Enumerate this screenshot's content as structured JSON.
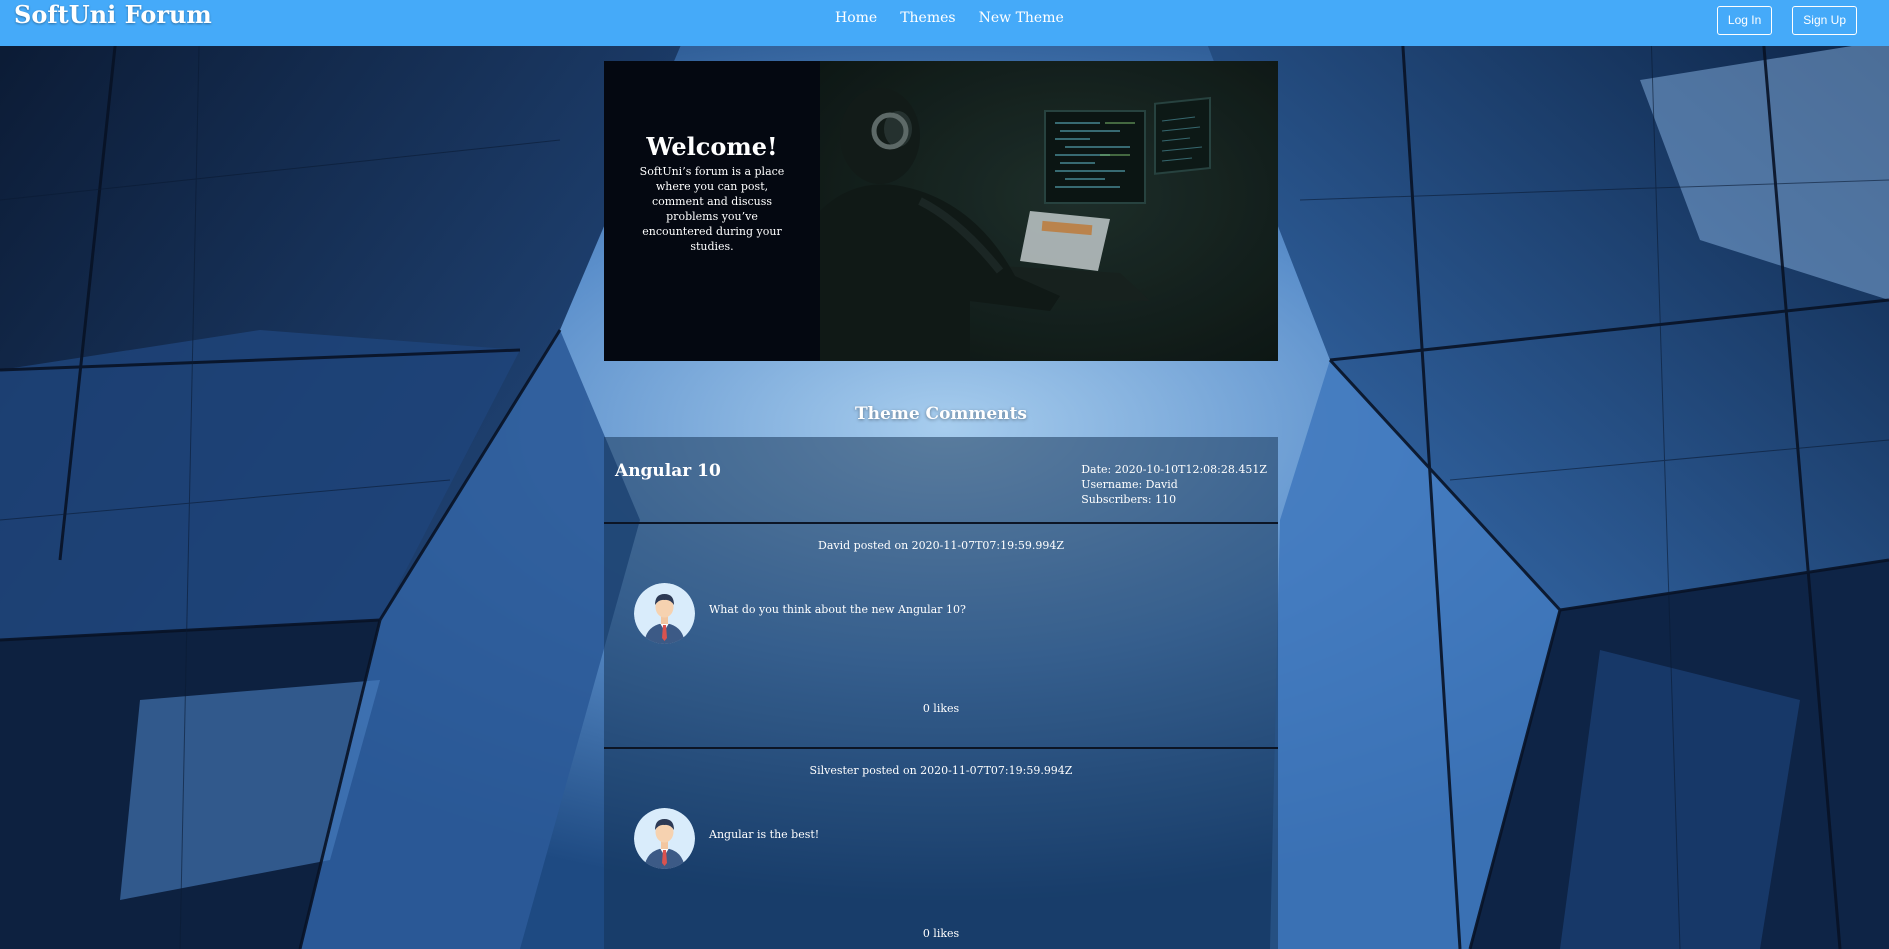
{
  "app": {
    "title": "SoftUni Forum"
  },
  "nav": {
    "home": "Home",
    "themes": "Themes",
    "new_theme": "New Theme"
  },
  "auth": {
    "login": "Log In",
    "signup": "Sign Up"
  },
  "banner": {
    "title": "Welcome!",
    "description": "SoftUni’s forum is a place where you can post, comment and discuss problems you’ve encountered during your studies."
  },
  "section": {
    "title": "Theme Comments"
  },
  "theme": {
    "name": "Angular 10",
    "date": "Date: 2020-10-10T12:08:28.451Z",
    "username": "Username: David",
    "subscribers": "Subscribers: 110"
  },
  "comments": [
    {
      "header": "David posted on 2020-11-07T07:19:59.994Z",
      "text": "What do you think about the new Angular 10?",
      "likes": "0 likes"
    },
    {
      "header": "Silvester posted on 2020-11-07T07:19:59.994Z",
      "text": "Angular is the best!",
      "likes": "0 likes"
    }
  ],
  "colors": {
    "header": "#45aaf9",
    "banner_dark": "#040811",
    "panel": "#1b3c63"
  },
  "icons": {
    "avatar": "user-avatar-icon"
  }
}
